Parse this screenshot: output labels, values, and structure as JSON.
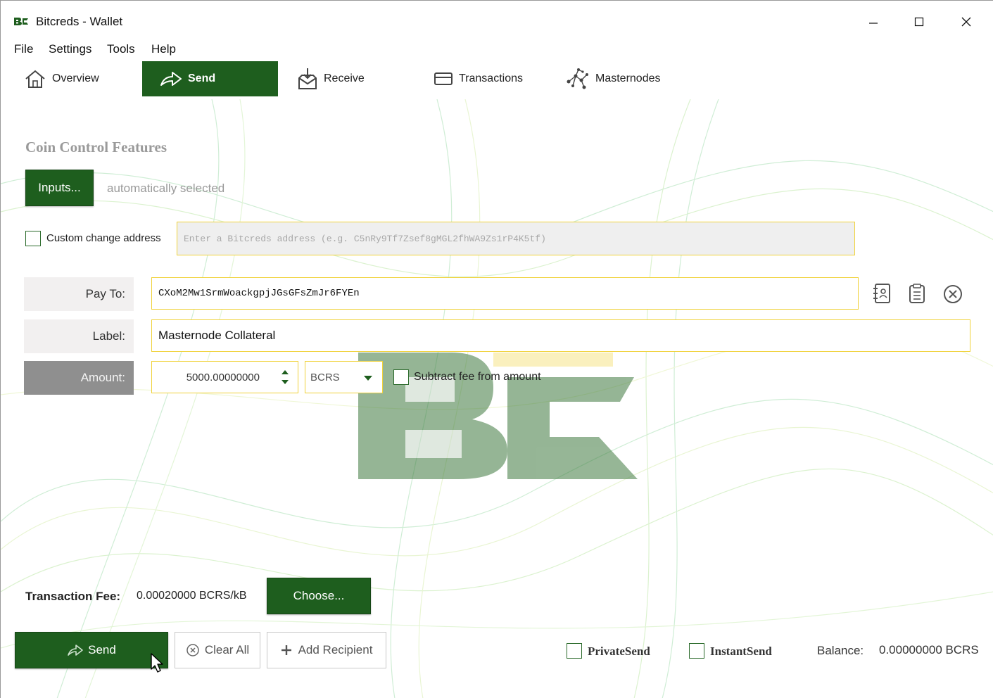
{
  "window": {
    "title": "Bitcreds - Wallet",
    "logo_text": "BC"
  },
  "menu": {
    "items": [
      "File",
      "Settings",
      "Tools",
      "Help"
    ]
  },
  "tabs": [
    {
      "label": "Overview",
      "icon": "home-icon",
      "active": false
    },
    {
      "label": "Send",
      "icon": "send-arrow-icon",
      "active": true
    },
    {
      "label": "Receive",
      "icon": "receive-inbox-icon",
      "active": false
    },
    {
      "label": "Transactions",
      "icon": "card-icon",
      "active": false
    },
    {
      "label": "Masternodes",
      "icon": "network-icon",
      "active": false
    }
  ],
  "coin_control": {
    "title": "Coin Control Features",
    "inputs_button": "Inputs...",
    "inputs_status": "automatically selected",
    "custom_change_label": "Custom change address",
    "custom_change_checked": false,
    "change_address_placeholder": "Enter a Bitcreds address (e.g. C5nRy9Tf7Zsef8gMGL2fhWA9Zs1rP4K5tf)"
  },
  "recipient": {
    "pay_to_label": "Pay To:",
    "pay_to_value": "CXoM2Mw1SrmWoackgpjJGsGFsZmJr6FYEn",
    "label_label": "Label:",
    "label_value": "Masternode Collateral",
    "amount_label": "Amount:",
    "amount_value": "5000.00000000",
    "unit": "BCRS",
    "subtract_fee_label": "Subtract fee from amount",
    "subtract_fee_checked": false
  },
  "fee": {
    "label": "Transaction Fee:",
    "value": "0.00020000 BCRS/kB",
    "choose_button": "Choose..."
  },
  "footer": {
    "send_button": "Send",
    "clear_all_button": "Clear All",
    "add_recipient_button": "Add Recipient",
    "private_send_label": "PrivateSend",
    "instant_send_label": "InstantSend",
    "balance_label": "Balance:",
    "balance_value": "0.00000000 BCRS"
  },
  "colors": {
    "accent_green": "#1e5e1e",
    "field_border": "#f0d23a",
    "muted_text": "#9a9a9a"
  }
}
